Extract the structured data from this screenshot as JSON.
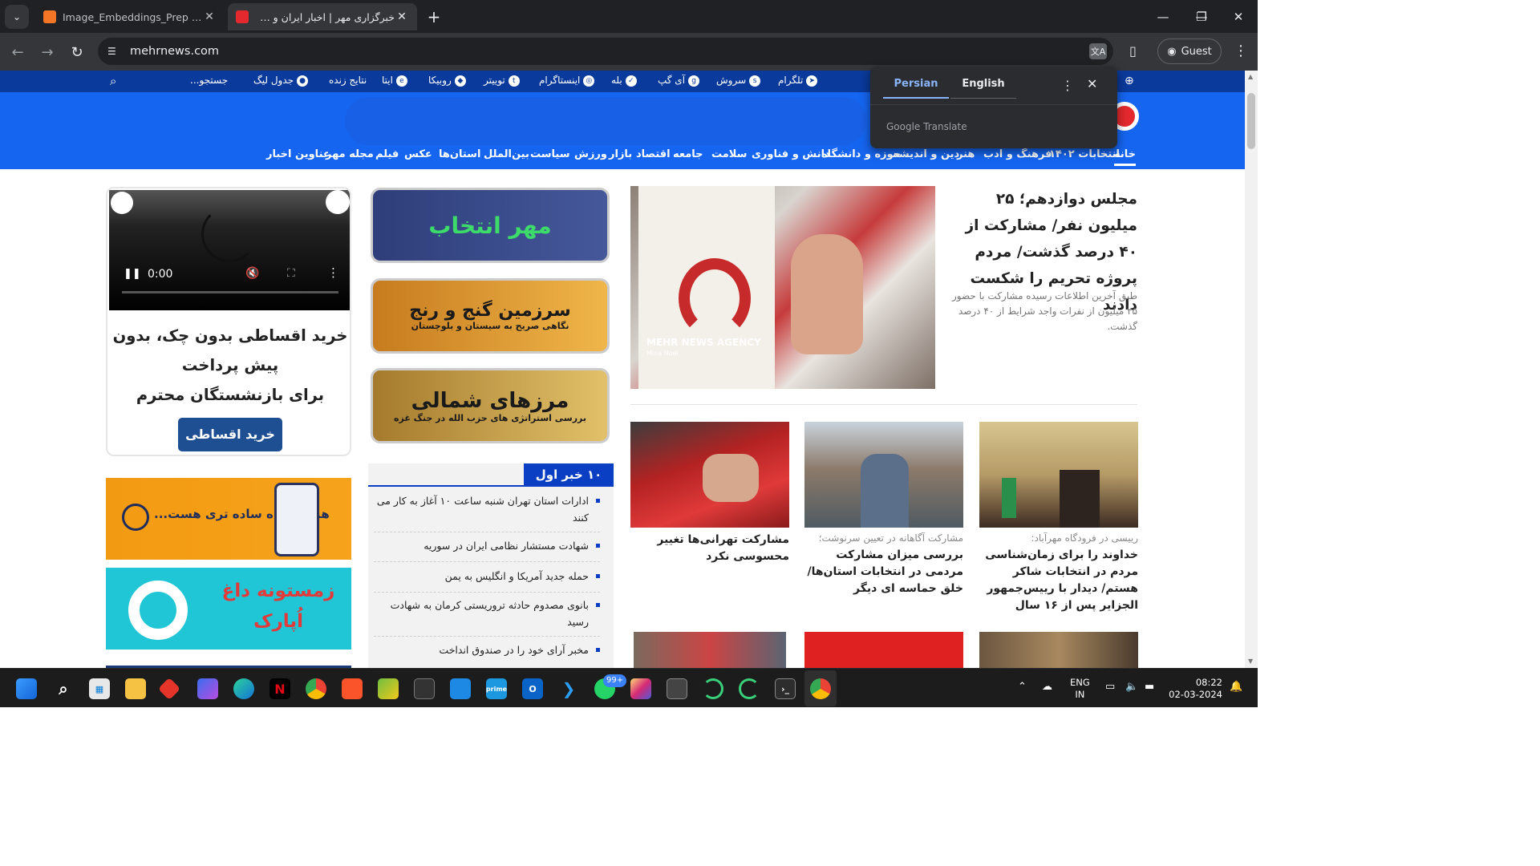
{
  "browser": {
    "tabs": [
      {
        "title": "Image_Embeddings_Prep - Jupy",
        "favicon_color": "#f37626",
        "active": false
      },
      {
        "title": "خبرگزاری مهر | اخبار ایران و جهان",
        "favicon_color": "#e4292e",
        "active": true
      }
    ],
    "url": "mehrnews.com",
    "profile_label": "Guest",
    "translate_popup": {
      "languages": [
        "Persian",
        "English"
      ],
      "selected": "Persian",
      "brand": "Google Translate"
    }
  },
  "site": {
    "topbar": {
      "social": [
        {
          "label": "تلگرام",
          "icon": "telegram-icon"
        },
        {
          "label": "سروش",
          "icon": "soroush-icon"
        },
        {
          "label": "آی گپ",
          "icon": "igap-icon"
        },
        {
          "label": "بله",
          "icon": "bale-icon"
        },
        {
          "label": "اینستاگرام",
          "icon": "instagram-icon"
        },
        {
          "label": "توییتر",
          "icon": "twitter-icon"
        },
        {
          "label": "روبیکا",
          "icon": "rubika-icon"
        },
        {
          "label": "ایتا",
          "icon": "eitaa-icon"
        }
      ],
      "live_results": "نتایج زنده",
      "league_table": "جدول لیگ",
      "search_placeholder": "جستجو..."
    },
    "nav": [
      "خانه",
      "انتخابات ۱۴۰۲",
      "فرهنگ و ادب",
      "هنر",
      "دین و اندیشه",
      "حوزه و دانشگاه",
      "دانش و فناوری",
      "سلامت",
      "جامعه",
      "اقتصاد",
      "بازار",
      "ورزش",
      "سیاست",
      "بین‌الملل",
      "استان‌ها",
      "عکس",
      "فیلم",
      "مجله مهر",
      "عناوین اخبار"
    ],
    "lead": {
      "title": "مجلس دوازدهم؛ ۲۵ میلیون نفر/ مشارکت از ۴۰ درصد گذشت/ مردم پروژه تحریم را شکست دادند",
      "summary": "طبق آخرین اطلاعات رسیده مشارکت با حضور ۲۵ میلیون از نفرات واجد شرایط از ۴۰ درصد گذشت.",
      "watermark": "MEHR NEWS AGENCY",
      "photographer": "Mina Noei"
    },
    "cards": [
      {
        "sub": "رییسی در فرودگاه مهرآباد:",
        "title": "خداوند را برای زمان‌شناسی مردم در انتخابات شاکر هستم/ دیدار با رییس‌جمهور الجزایر پس از ۱۶ سال"
      },
      {
        "sub": "مشارکت آگاهانه در تعیین سرنوشت؛",
        "title": "بررسی میزان مشارکت مردمی در انتخابات استان‌ها/ خلق حماسه ای دیگر"
      },
      {
        "sub": "",
        "title": "مشارکت تهرانی‌ها تغییر محسوسی نکرد"
      }
    ],
    "banners": [
      {
        "title": "مهر انتخاب",
        "subtitle": "",
        "bg": "#3c4f8c"
      },
      {
        "title": "سرزمین گنج و رنج",
        "subtitle": "نگاهی صریح به سیستان و بلوچستان",
        "bg": "#e9a93a"
      },
      {
        "title": "مرزهای شمالی",
        "subtitle": "بررسی استراتژی های حزب الله در جنگ غزه",
        "bg": "#c89a3c"
      }
    ],
    "top10": {
      "heading": "۱۰ خبر اول",
      "items": [
        "ادارات استان تهران شنبه ساعت ۱۰ آغاز به کار می کنند",
        "شهادت مستشار نظامی ایران در سوریه",
        "حمله جدید آمریکا و انگلیس به یمن",
        "بانوی مصدوم حادثه تروریستی کرمان به شهادت رسید",
        "مخبر آرای خود را در صندوق انداخت"
      ]
    },
    "ads": {
      "video_time": "0:00",
      "installment_text_1": "خرید اقساطی بدون چک، بدون پیش پرداخت",
      "installment_text_2": "برای بازنشستگان محترم",
      "installment_button": "خرید اقساطی",
      "insurance_text": "همیشه راه ساده تری هست...",
      "park_text": "زمستونه داغ اُپارک"
    }
  },
  "taskbar": {
    "notification_badge": "99+",
    "lang_line1": "ENG",
    "lang_line2": "IN",
    "time": "08:22",
    "date": "02-03-2024"
  }
}
